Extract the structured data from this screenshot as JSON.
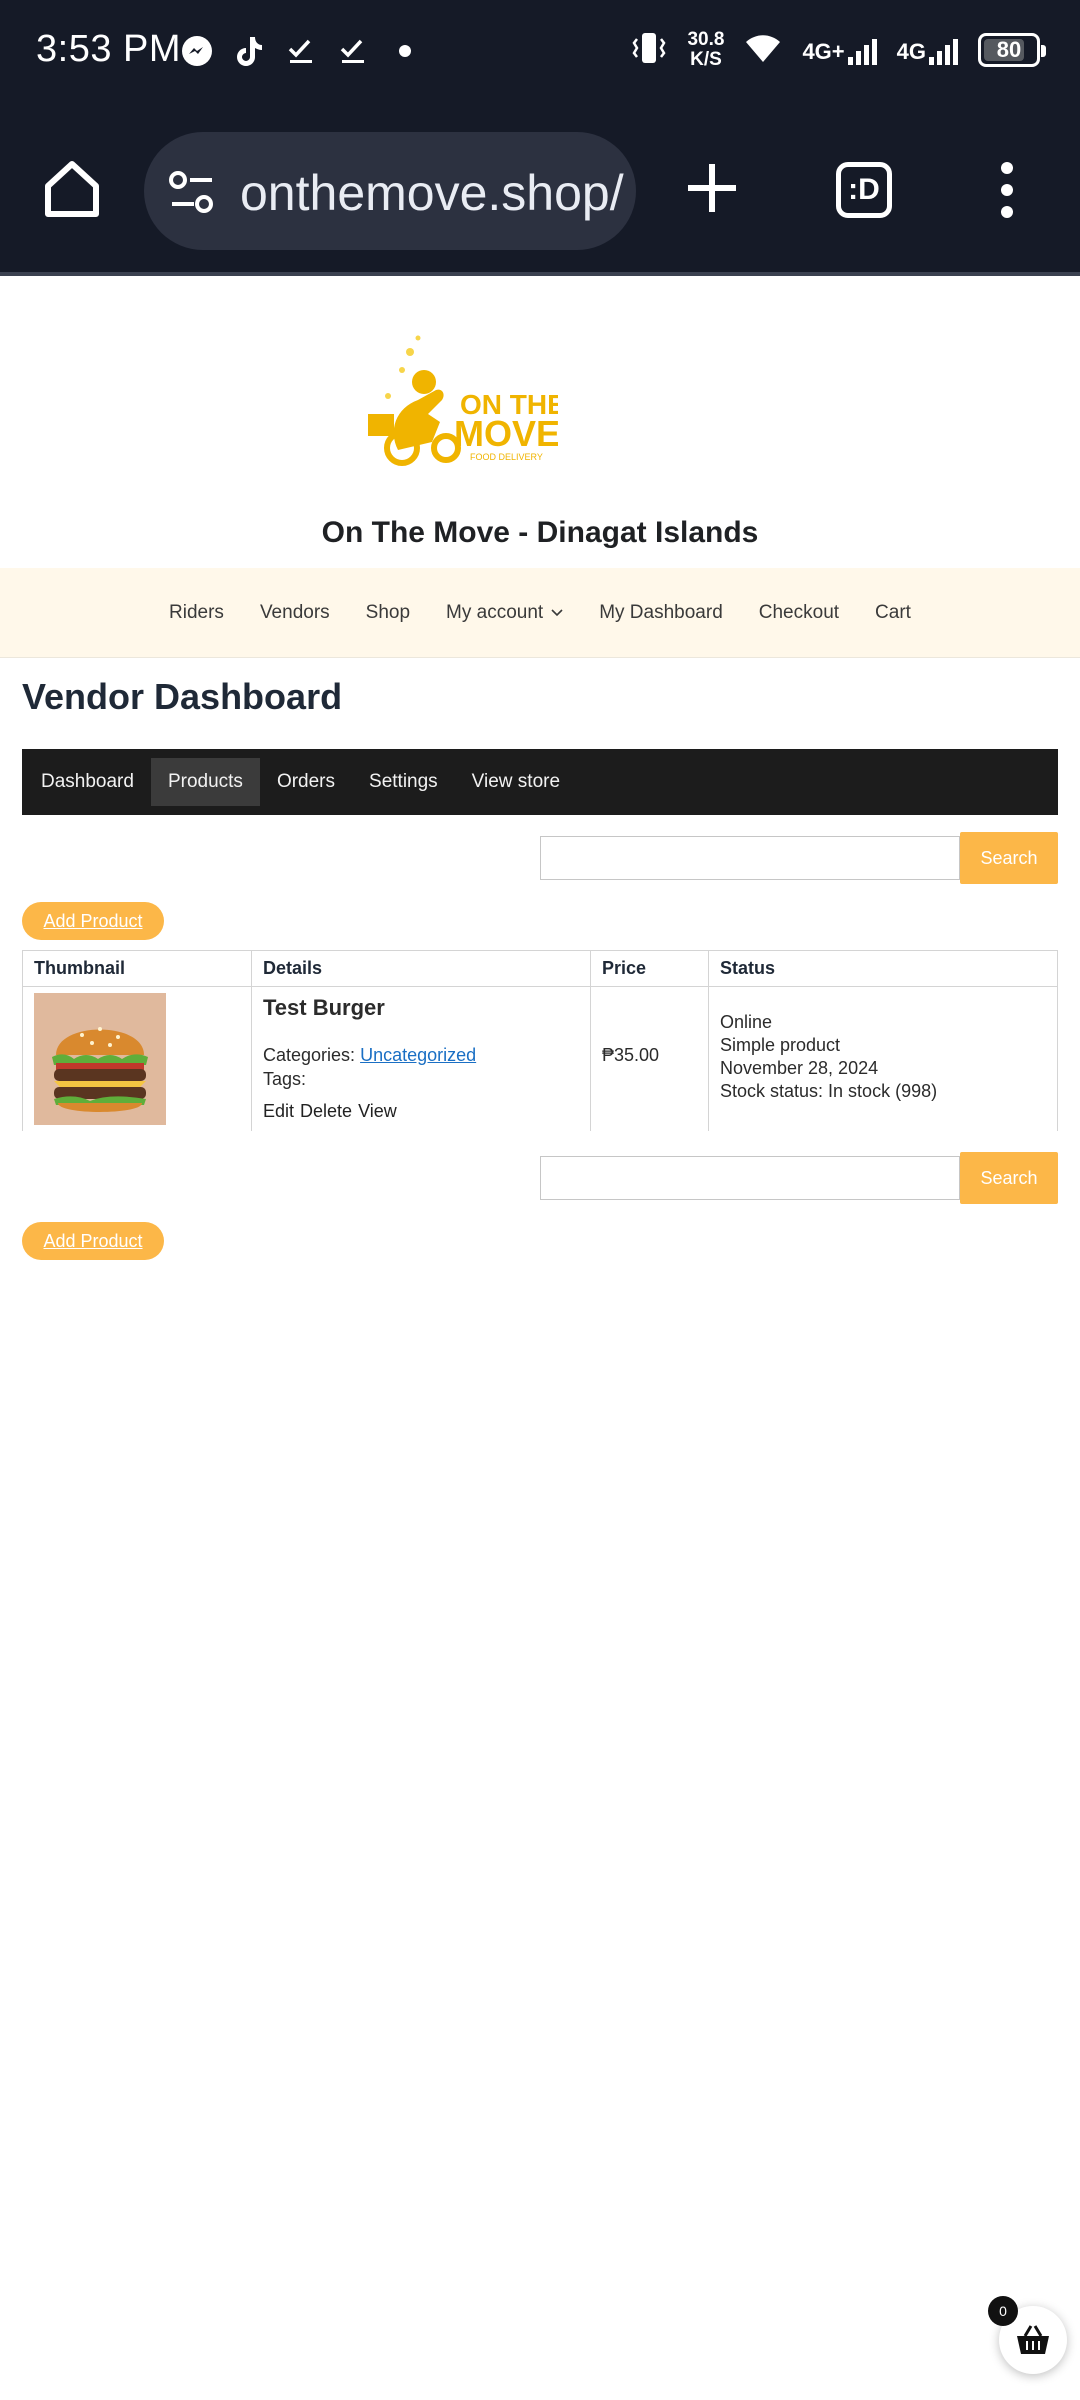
{
  "status_bar": {
    "time": "3:53 PM",
    "notifications": [
      "messenger-icon",
      "tiktok-icon",
      "check-icon",
      "check-icon",
      "dot-icon"
    ],
    "speed_value": "30.8",
    "speed_unit": "K/S",
    "net1": "4G+",
    "net2": "4G",
    "battery": "80",
    "battery_level": 0.8
  },
  "browser": {
    "url": "onthemove.shop/",
    "tabs_label": ":D"
  },
  "site": {
    "title": "On The Move - Dinagat Islands",
    "logo": {
      "line1": "ON THE",
      "line2": "MOVE",
      "tagline": "FOOD DELIVERY"
    },
    "accent": "#fcb748",
    "nav": [
      {
        "label": "Riders"
      },
      {
        "label": "Vendors"
      },
      {
        "label": "Shop"
      },
      {
        "label": "My account"
      },
      {
        "label": "My Dashboard"
      },
      {
        "label": "Checkout"
      },
      {
        "label": "Cart"
      }
    ]
  },
  "dashboard": {
    "title": "Vendor Dashboard",
    "tabs": [
      "Dashboard",
      "Products",
      "Orders",
      "Settings",
      "View store"
    ],
    "active_tab": "Products",
    "search_button": "Search",
    "search_placeholder": "",
    "add_product": "Add Product",
    "table": {
      "headers": [
        "Thumbnail",
        "Details",
        "Price",
        "Status"
      ],
      "rows": [
        {
          "name": "Test Burger",
          "categories_label": "Categories:",
          "category": "Uncategorized",
          "tags_label": "Tags:",
          "actions": [
            "Edit",
            "Delete",
            "View"
          ],
          "price": "₱35.00",
          "status": [
            "Online",
            "Simple product",
            "November 28, 2024",
            "Stock status: In stock (998)"
          ]
        }
      ]
    }
  },
  "mini_cart": {
    "count": "0"
  }
}
